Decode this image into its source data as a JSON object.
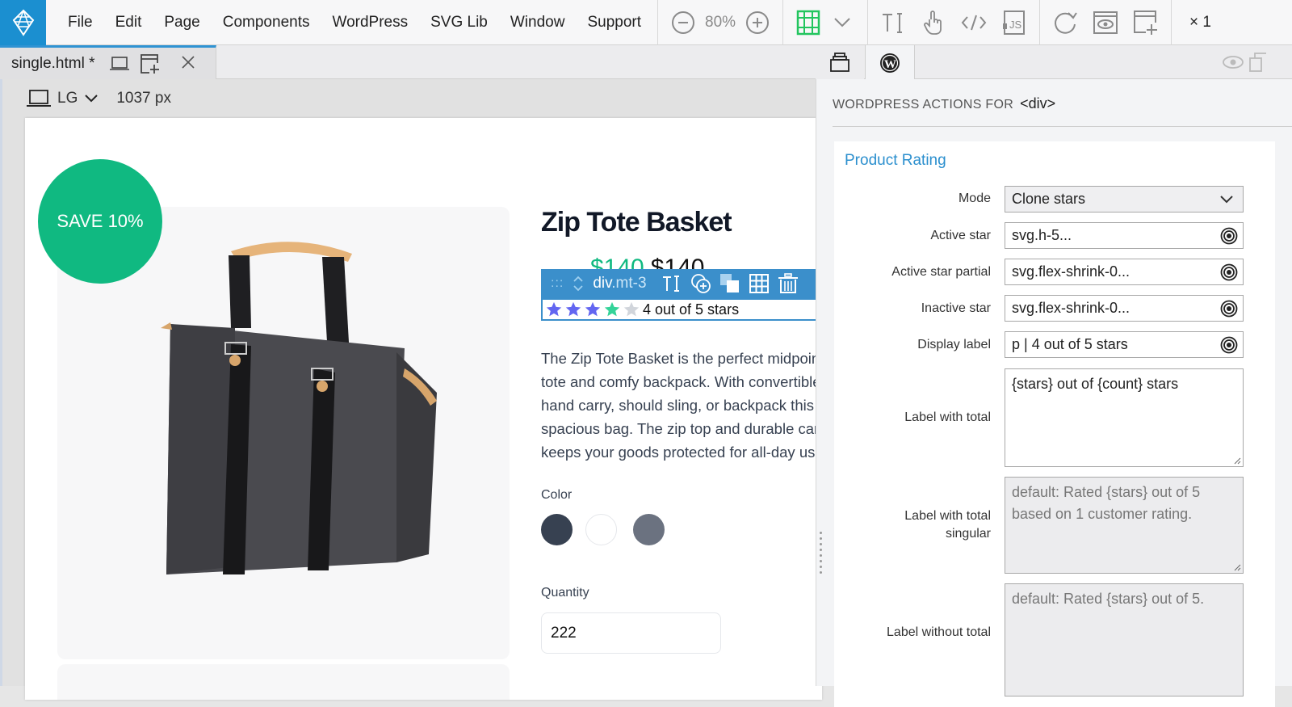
{
  "app": {
    "menu": [
      "File",
      "Edit",
      "Page",
      "Components",
      "WordPress",
      "SVG Lib",
      "Window",
      "Support"
    ],
    "zoom_level": "80%",
    "multiplier": "× 1",
    "brand_color": "#1b8fd0"
  },
  "tabs": {
    "document": "single.html *",
    "panel_tabs": [
      "project-files",
      "wordpress"
    ]
  },
  "viewport": {
    "size_label": "LG",
    "width": "1037 px"
  },
  "page": {
    "badge": "SAVE 10%",
    "title": "Zip Tote Basket",
    "price_sale": "$140",
    "price_regular": "$140",
    "selection": {
      "tag": "div",
      "class": ".mt-3"
    },
    "rating": {
      "value": 4,
      "max": 5,
      "label": "4 out of 5 stars"
    },
    "description": [
      "The Zip Tote Basket is the perfect midpoint between shopping",
      "tote and comfy backpack. With convertible straps, you can",
      "hand carry, should sling, or backpack this convenient and",
      "spacious bag. The zip top and durable canvas construction",
      "keeps your goods protected for all-day use."
    ],
    "color_label": "Color",
    "colors": [
      "#374151",
      "#ffffff",
      "#6b7280"
    ],
    "quantity_label": "Quantity",
    "quantity_value": "222"
  },
  "panel": {
    "header": "WORDPRESS ACTIONS FOR",
    "element": "<div>",
    "section_title": "Product Rating",
    "fields": {
      "mode_label": "Mode",
      "mode_value": "Clone stars",
      "active_star_label": "Active star",
      "active_star_value": "svg.h-5...",
      "active_partial_label": "Active star partial",
      "active_partial_value": "svg.flex-shrink-0...",
      "inactive_star_label": "Inactive star",
      "inactive_star_value": "svg.flex-shrink-0...",
      "display_label_label": "Display label",
      "display_label_value": "p | 4 out of 5 stars",
      "label_total_label": "Label with total",
      "label_total_value": "{stars} out of {count} stars",
      "label_total_singular_label_1": "Label with total",
      "label_total_singular_label_2": "singular",
      "label_total_singular_placeholder": "default: Rated {stars} out of 5 based on 1 customer rating.",
      "label_without_total_label": "Label without total",
      "label_without_total_placeholder": "default: Rated {stars} out of 5."
    }
  }
}
